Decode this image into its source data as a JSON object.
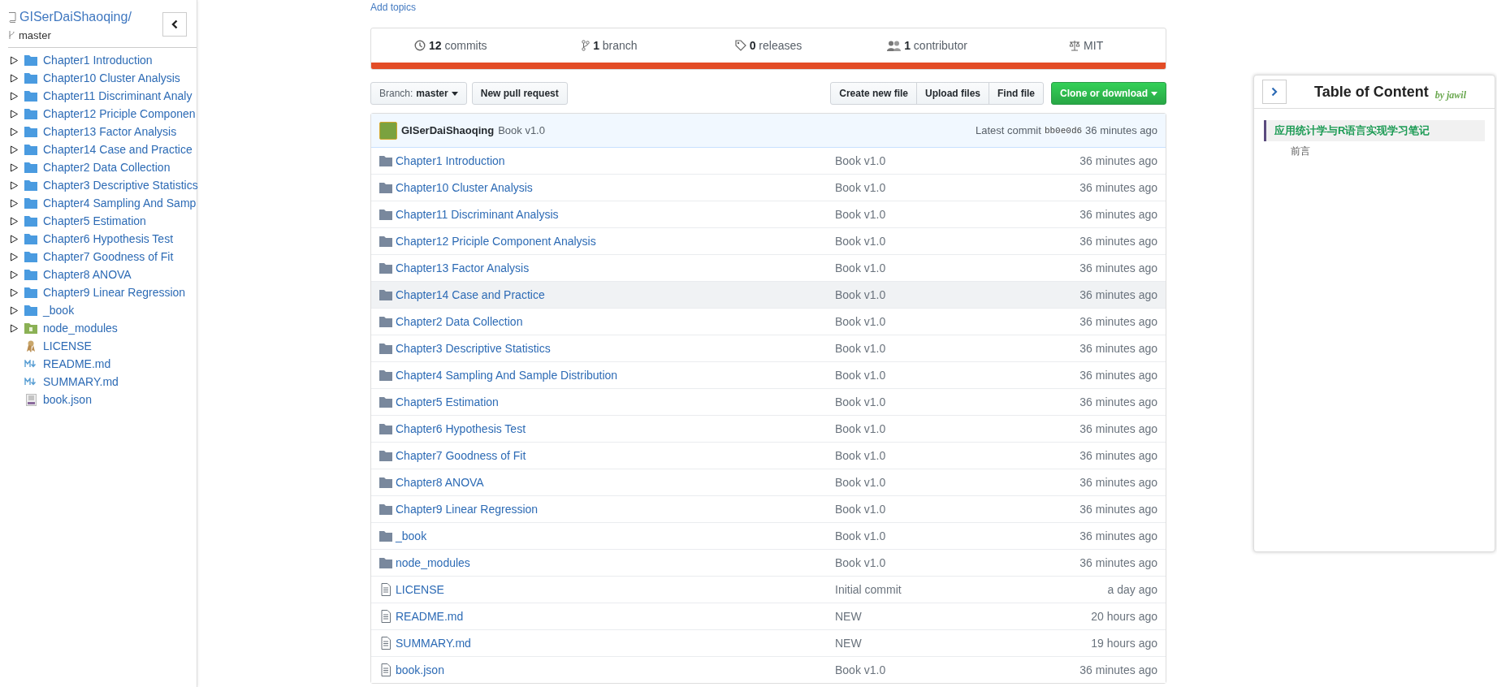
{
  "sidebar": {
    "repo": "GISerDaiShaoqing/",
    "branch": "master",
    "items": [
      {
        "kind": "folder",
        "name": "Chapter1 Introduction",
        "expanded": false
      },
      {
        "kind": "folder",
        "name": "Chapter10 Cluster Analysis",
        "expanded": false
      },
      {
        "kind": "folder",
        "name": "Chapter11 Discriminant Analy",
        "expanded": false
      },
      {
        "kind": "folder",
        "name": "Chapter12 Priciple Componen",
        "expanded": false
      },
      {
        "kind": "folder",
        "name": "Chapter13 Factor Analysis",
        "expanded": false
      },
      {
        "kind": "folder",
        "name": "Chapter14 Case and Practice",
        "expanded": false
      },
      {
        "kind": "folder",
        "name": "Chapter2 Data Collection",
        "expanded": false
      },
      {
        "kind": "folder",
        "name": "Chapter3 Descriptive Statistics",
        "expanded": false
      },
      {
        "kind": "folder",
        "name": "Chapter4 Sampling And Samp",
        "expanded": false
      },
      {
        "kind": "folder",
        "name": "Chapter5 Estimation",
        "expanded": false
      },
      {
        "kind": "folder",
        "name": "Chapter6 Hypothesis Test",
        "expanded": false
      },
      {
        "kind": "folder",
        "name": "Chapter7 Goodness of Fit",
        "expanded": false
      },
      {
        "kind": "folder",
        "name": "Chapter8 ANOVA",
        "expanded": false
      },
      {
        "kind": "folder",
        "name": "Chapter9 Linear Regression",
        "expanded": false
      },
      {
        "kind": "folder",
        "name": "_book",
        "expanded": false
      },
      {
        "kind": "package",
        "name": "node_modules",
        "expanded": false
      },
      {
        "kind": "license",
        "name": "LICENSE"
      },
      {
        "kind": "markdown",
        "name": "README.md"
      },
      {
        "kind": "markdown",
        "name": "SUMMARY.md"
      },
      {
        "kind": "json",
        "name": "book.json"
      }
    ]
  },
  "repo": {
    "add_topics": "Add topics",
    "summary": [
      {
        "kind": "commits",
        "text": "**12** commits"
      },
      {
        "kind": "branches",
        "text": "**1** branch"
      },
      {
        "kind": "releases",
        "text": "**0** releases"
      },
      {
        "kind": "contributors",
        "text": "**1** contributor"
      },
      {
        "kind": "license",
        "text": "MIT"
      }
    ],
    "branch_button": {
      "label": "Branch:",
      "value": "master"
    },
    "pull_request_button": "New pull request",
    "file_buttons": [
      "Create new file",
      "Upload files",
      "Find file"
    ],
    "clone_button": "Clone or download",
    "commit": {
      "author": "GISerDaiShaoqing",
      "message": "Book v1.0",
      "label": "Latest commit",
      "sha": "bb0e0d6",
      "time": "36 minutes ago"
    },
    "files": [
      {
        "kind": "folder",
        "name": "Chapter1 Introduction",
        "message": "Book v1.0",
        "age": "36 minutes ago",
        "highlighted": false
      },
      {
        "kind": "folder",
        "name": "Chapter10 Cluster Analysis",
        "message": "Book v1.0",
        "age": "36 minutes ago",
        "highlighted": false
      },
      {
        "kind": "folder",
        "name": "Chapter11 Discriminant Analysis",
        "message": "Book v1.0",
        "age": "36 minutes ago",
        "highlighted": false
      },
      {
        "kind": "folder",
        "name": "Chapter12 Priciple Component Analysis",
        "message": "Book v1.0",
        "age": "36 minutes ago",
        "highlighted": false
      },
      {
        "kind": "folder",
        "name": "Chapter13 Factor Analysis",
        "message": "Book v1.0",
        "age": "36 minutes ago",
        "highlighted": false
      },
      {
        "kind": "folder",
        "name": "Chapter14 Case and Practice",
        "message": "Book v1.0",
        "age": "36 minutes ago",
        "highlighted": true
      },
      {
        "kind": "folder",
        "name": "Chapter2 Data Collection",
        "message": "Book v1.0",
        "age": "36 minutes ago",
        "highlighted": false
      },
      {
        "kind": "folder",
        "name": "Chapter3 Descriptive Statistics",
        "message": "Book v1.0",
        "age": "36 minutes ago",
        "highlighted": false
      },
      {
        "kind": "folder",
        "name": "Chapter4 Sampling And Sample Distribution",
        "message": "Book v1.0",
        "age": "36 minutes ago",
        "highlighted": false
      },
      {
        "kind": "folder",
        "name": "Chapter5 Estimation",
        "message": "Book v1.0",
        "age": "36 minutes ago",
        "highlighted": false
      },
      {
        "kind": "folder",
        "name": "Chapter6 Hypothesis Test",
        "message": "Book v1.0",
        "age": "36 minutes ago",
        "highlighted": false
      },
      {
        "kind": "folder",
        "name": "Chapter7 Goodness of Fit",
        "message": "Book v1.0",
        "age": "36 minutes ago",
        "highlighted": false
      },
      {
        "kind": "folder",
        "name": "Chapter8 ANOVA",
        "message": "Book v1.0",
        "age": "36 minutes ago",
        "highlighted": false
      },
      {
        "kind": "folder",
        "name": "Chapter9 Linear Regression",
        "message": "Book v1.0",
        "age": "36 minutes ago",
        "highlighted": false
      },
      {
        "kind": "folder",
        "name": "_book",
        "message": "Book v1.0",
        "age": "36 minutes ago",
        "highlighted": false
      },
      {
        "kind": "folder",
        "name": "node_modules",
        "message": "Book v1.0",
        "age": "36 minutes ago",
        "highlighted": false
      },
      {
        "kind": "file",
        "name": "LICENSE",
        "message": "Initial commit",
        "age": "a day ago",
        "highlighted": false
      },
      {
        "kind": "file",
        "name": "README.md",
        "message": "NEW",
        "age": "20 hours ago",
        "highlighted": false
      },
      {
        "kind": "file",
        "name": "SUMMARY.md",
        "message": "NEW",
        "age": "19 hours ago",
        "highlighted": false
      },
      {
        "kind": "file",
        "name": "book.json",
        "message": "Book v1.0",
        "age": "36 minutes ago",
        "highlighted": false
      }
    ]
  },
  "toc": {
    "title": "Table of Content",
    "byline": "by jawil",
    "items": [
      {
        "title": "应用统计学与R语言实现学习笔记",
        "selected": true,
        "children": [
          {
            "title": "前言",
            "selected": false
          }
        ]
      }
    ]
  }
}
